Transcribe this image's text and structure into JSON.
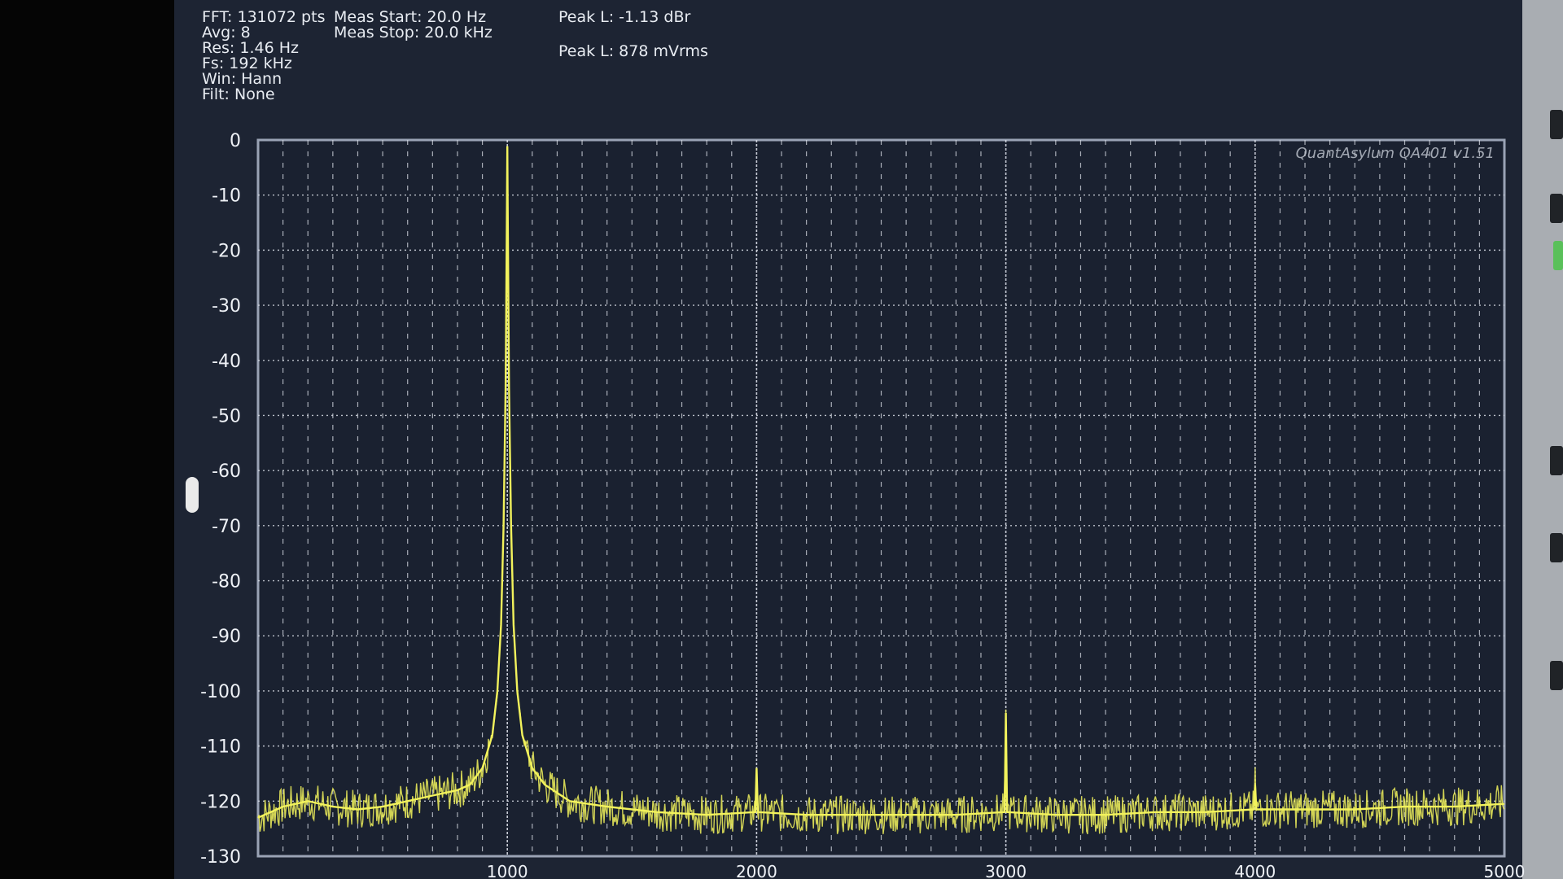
{
  "readout": {
    "left": [
      "FFT: 131072 pts",
      "Avg: 8",
      "Res: 1.46 Hz",
      "Fs: 192 kHz",
      "Win: Hann",
      "Filt: None"
    ],
    "meas_start": "Meas Start: 20.0 Hz",
    "meas_stop": "Meas Stop: 20.0 kHz",
    "peak_dbr": "Peak L: -1.13 dBr",
    "peak_vrms": "Peak L: 878 mVrms"
  },
  "chart_data": {
    "type": "line",
    "title": "",
    "watermark": "QuantAsylum QA401 v1.51",
    "xlabel": "",
    "ylabel": "",
    "xlim": [
      0,
      5000
    ],
    "ylim": [
      -130,
      0
    ],
    "y_ticks": [
      "0",
      "-10",
      "-20",
      "-30",
      "-40",
      "-50",
      "-60",
      "-70",
      "-80",
      "-90",
      "-100",
      "-110",
      "-120",
      "-130"
    ],
    "x_ticks": [
      "1000",
      "2000",
      "3000",
      "4000",
      "5000"
    ],
    "grid": true,
    "colors": {
      "trace": "#f2f25c",
      "grid": "#d9dde6",
      "background": "#1d2433",
      "frame": "#9aa3b5"
    },
    "series": [
      {
        "values": [
          [
            0,
            -123
          ],
          [
            100,
            -121
          ],
          [
            200,
            -120
          ],
          [
            300,
            -121
          ],
          [
            400,
            -121.5
          ],
          [
            500,
            -121
          ],
          [
            600,
            -120
          ],
          [
            700,
            -119
          ],
          [
            800,
            -118
          ],
          [
            850,
            -117
          ],
          [
            900,
            -114
          ],
          [
            940,
            -108
          ],
          [
            960,
            -100
          ],
          [
            975,
            -88
          ],
          [
            985,
            -70
          ],
          [
            993,
            -45
          ],
          [
            998,
            -15
          ],
          [
            1000,
            -1.13
          ],
          [
            1002,
            -15
          ],
          [
            1007,
            -45
          ],
          [
            1015,
            -70
          ],
          [
            1025,
            -88
          ],
          [
            1040,
            -100
          ],
          [
            1060,
            -108
          ],
          [
            1100,
            -114
          ],
          [
            1150,
            -117
          ],
          [
            1250,
            -120
          ],
          [
            1400,
            -121
          ],
          [
            1600,
            -122
          ],
          [
            1800,
            -122.5
          ],
          [
            1995,
            -122
          ],
          [
            2000,
            -114
          ],
          [
            2005,
            -122
          ],
          [
            2200,
            -122.5
          ],
          [
            2400,
            -122.5
          ],
          [
            2600,
            -122.5
          ],
          [
            2800,
            -122.5
          ],
          [
            2995,
            -122
          ],
          [
            3000,
            -104
          ],
          [
            3005,
            -122
          ],
          [
            3200,
            -122.5
          ],
          [
            3400,
            -122.5
          ],
          [
            3600,
            -122
          ],
          [
            3800,
            -122
          ],
          [
            3995,
            -121.5
          ],
          [
            4000,
            -117
          ],
          [
            4005,
            -121.5
          ],
          [
            4200,
            -121.5
          ],
          [
            4400,
            -121.5
          ],
          [
            4600,
            -121
          ],
          [
            4800,
            -121
          ],
          [
            5000,
            -120.5
          ]
        ]
      }
    ]
  }
}
